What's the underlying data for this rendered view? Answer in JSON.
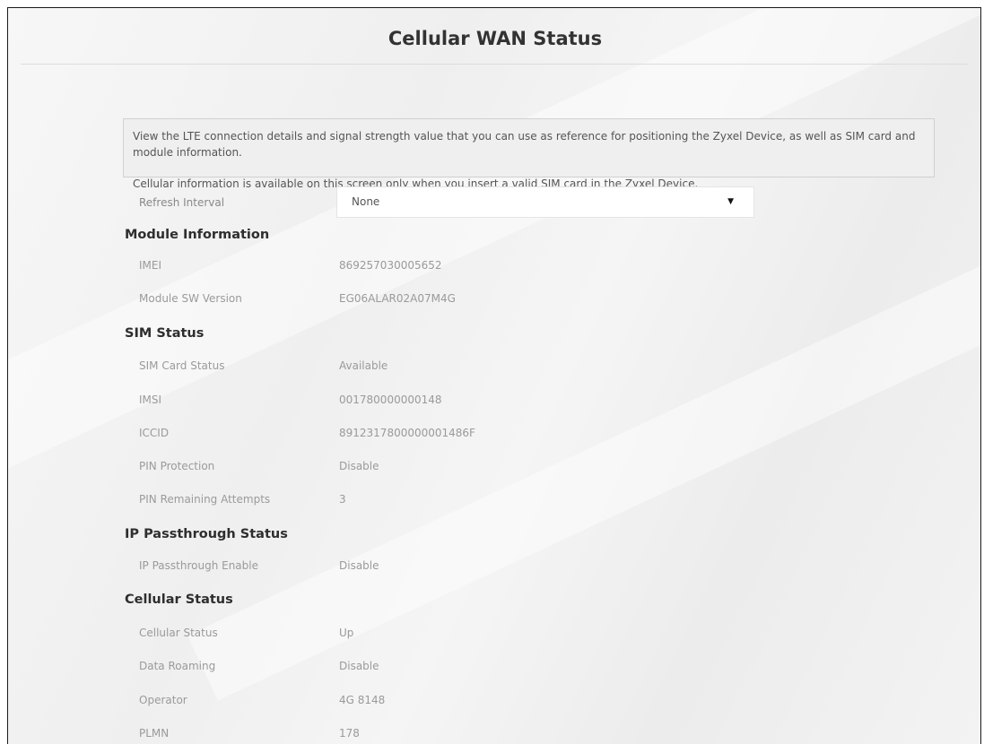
{
  "page": {
    "title": "Cellular WAN Status"
  },
  "info": {
    "line1": "View the LTE connection details and signal strength value that you can use as reference for positioning the Zyxel Device, as well as SIM card and module information.",
    "line2": "Cellular information is available on this screen only when you insert a valid SIM card in the Zyxel Device."
  },
  "refresh": {
    "label": "Refresh Interval",
    "selected": "None"
  },
  "module": {
    "heading": "Module Information",
    "imei_label": "IMEI",
    "imei_value": "869257030005652",
    "sw_label": "Module SW Version",
    "sw_value": "EG06ALAR02A07M4G"
  },
  "sim": {
    "heading": "SIM Status",
    "card_label": "SIM Card Status",
    "card_value": "Available",
    "imsi_label": "IMSI",
    "imsi_value": "001780000000148",
    "iccid_label": "ICCID",
    "iccid_value": "8912317800000001486F",
    "pin_label": "PIN Protection",
    "pin_value": "Disable",
    "attempts_label": "PIN Remaining Attempts",
    "attempts_value": "3"
  },
  "passthrough": {
    "heading": "IP Passthrough Status",
    "enable_label": "IP Passthrough Enable",
    "enable_value": "Disable"
  },
  "cellular": {
    "heading": "Cellular Status",
    "status_label": "Cellular Status",
    "status_value": "Up",
    "roaming_label": "Data Roaming",
    "roaming_value": "Disable",
    "operator_label": "Operator",
    "operator_value": "4G 8148",
    "plmn_label": "PLMN",
    "plmn_value": "178"
  },
  "colors": {
    "heading": "#2e2e2e",
    "label": "#9a9a9a",
    "info_bg": "#efefef"
  }
}
